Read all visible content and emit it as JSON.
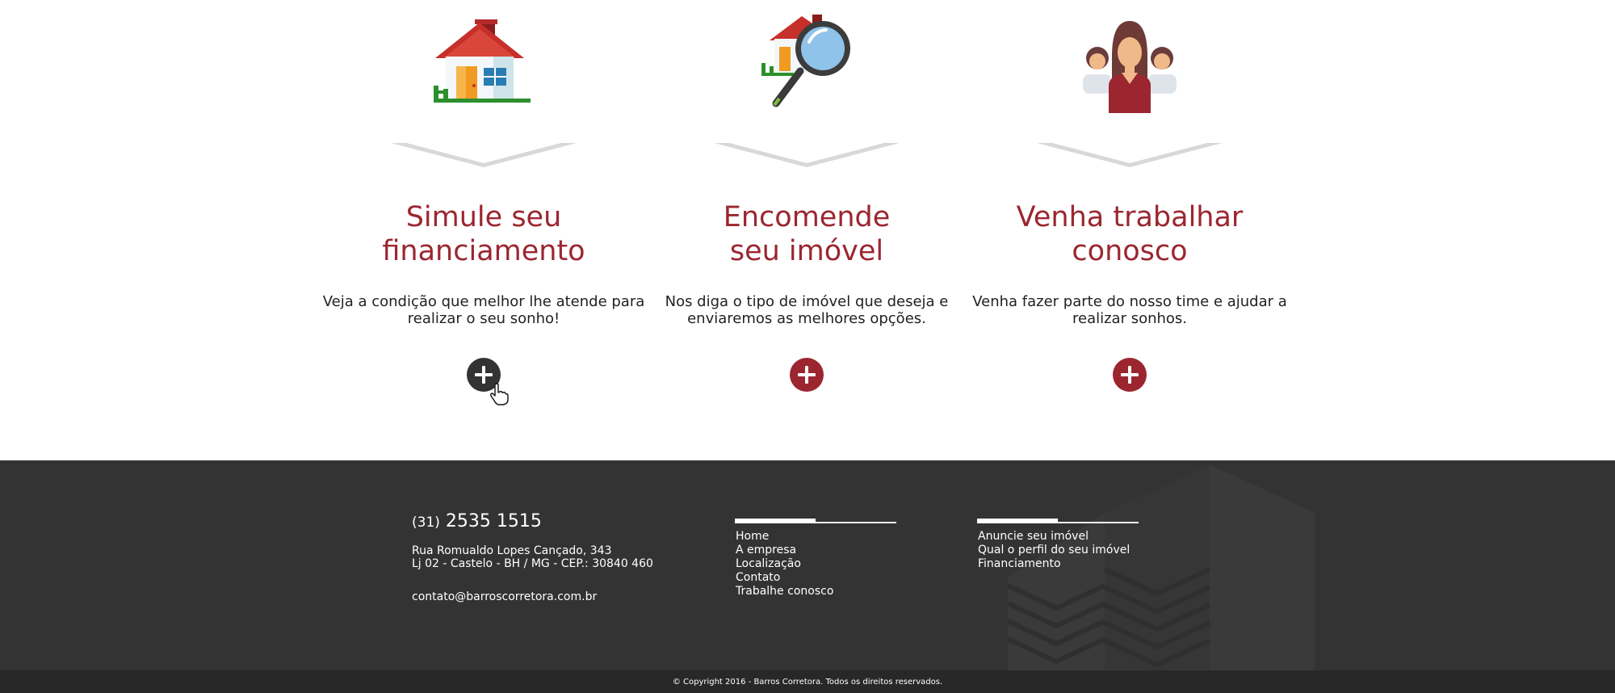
{
  "features": [
    {
      "icon": "house-icon",
      "title_line1": "Simule seu",
      "title_line2": "financiamento",
      "text": "Veja a condição que melhor lhe atende para realizar o seu sonho!",
      "button_icon": "plus-icon",
      "button_state": "hover"
    },
    {
      "icon": "house-search-icon",
      "title_line1": "Encomende",
      "title_line2": "seu imóvel",
      "text": "Nos diga o tipo de imóvel que deseja e enviaremos as melhores opções.",
      "button_icon": "plus-icon",
      "button_state": "default"
    },
    {
      "icon": "team-icon",
      "title_line1": "Venha trabalhar",
      "title_line2": "conosco",
      "text": "Venha fazer parte do nosso time e ajudar a realizar sonhos.",
      "button_icon": "plus-icon",
      "button_state": "default"
    }
  ],
  "footer": {
    "phone_ddd": "(31)",
    "phone_number": "2535 1515",
    "address_line1": "Rua Romualdo Lopes Cançado, 343",
    "address_line2": "Lj 02 - Castelo - BH / MG - CEP.: 30840 460",
    "email": "contato@barroscorretora.com.br",
    "nav1": [
      "Home",
      "A empresa",
      "Localização",
      "Contato",
      "Trabalhe conosco"
    ],
    "nav2": [
      "Anuncie seu imóvel",
      "Qual o perfil do seu imóvel",
      "Financiamento"
    ]
  },
  "copyright": "© Copyright 2016 - Barros Corretora. Todos os direitos reservados.",
  "colors": {
    "accent": "#9b2630",
    "footer_bg": "#333333",
    "copyright_bg": "#282828",
    "button_hover": "#333333"
  }
}
